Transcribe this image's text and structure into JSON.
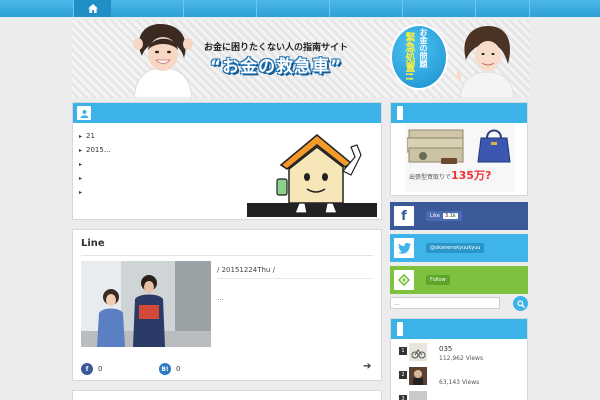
{
  "nav": {
    "home_icon": "home-icon"
  },
  "banner": {
    "subtitle": "お金に困りたくない人の指南サイト",
    "title": "“お金の救急車”",
    "badge_small": "お金の問題",
    "badge_large": "緊急処置!!"
  },
  "archive": {
    "items": [
      "21",
      "2015...",
      "",
      "",
      ""
    ]
  },
  "post": {
    "title": "Line",
    "date": "/ 20151224Thu /",
    "excerpt": "...",
    "facebook_count": "0",
    "hatena_count": "0",
    "facebook_letter": "f",
    "hatena_letter": "B!"
  },
  "ad": {
    "caption": "出張型買取りで",
    "price": "135万?"
  },
  "social": {
    "facebook_letter": "f",
    "facebook_like": "Like",
    "facebook_count": "3.1k",
    "twitter_handle": "@okanenokyuukyuu",
    "feedly_label": "Follow"
  },
  "search": {
    "placeholder": "..."
  },
  "ranking": [
    {
      "rank": "1",
      "title": "035",
      "views": "112,962 Views"
    },
    {
      "rank": "2",
      "title": "",
      "views": "63,143 Views"
    },
    {
      "rank": "3",
      "title": "",
      "views": ""
    }
  ],
  "colors": {
    "accent": "#3bb3e8",
    "facebook": "#3b5a9a",
    "twitter": "#3fb4e8",
    "feedly": "#7cc23f"
  }
}
